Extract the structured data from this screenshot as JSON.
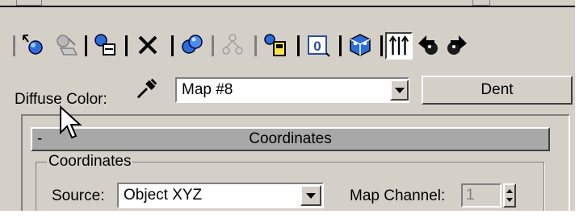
{
  "toolbar": {
    "buttons": [
      {
        "name": "pick-material-from-object-icon",
        "pressed": false
      },
      {
        "name": "put-material-to-scene-icon",
        "pressed": false
      },
      {
        "name": "assign-material-to-selection-icon",
        "pressed": false
      },
      {
        "name": "reset-map-icon",
        "pressed": false
      },
      {
        "name": "make-material-copy-icon",
        "pressed": false
      },
      {
        "name": "make-unique-icon",
        "pressed": false
      },
      {
        "name": "put-to-library-icon",
        "pressed": false
      },
      {
        "name": "material-effects-channel-icon",
        "pressed": false
      },
      {
        "name": "show-map-in-viewport-icon",
        "pressed": false
      },
      {
        "name": "show-end-result-icon",
        "pressed": true
      },
      {
        "name": "go-to-parent-icon",
        "pressed": false
      },
      {
        "name": "go-forward-to-sibling-icon",
        "pressed": false
      }
    ]
  },
  "map_row": {
    "label": "Diffuse Color:",
    "dropper_icon": "eyedropper-icon",
    "map_name": "Map #8",
    "map_type_button": "Dent"
  },
  "rollout": {
    "toggle": "-",
    "title": "Coordinates"
  },
  "coordinates_group": {
    "title": "Coordinates",
    "source_label": "Source:",
    "source_value": "Object XYZ",
    "map_channel_label": "Map Channel:",
    "map_channel_value": "1"
  },
  "colors": {
    "ui_face": "#d4d0c8",
    "rollout_bar": "#a8a8a8",
    "disabled_text": "#808080"
  }
}
